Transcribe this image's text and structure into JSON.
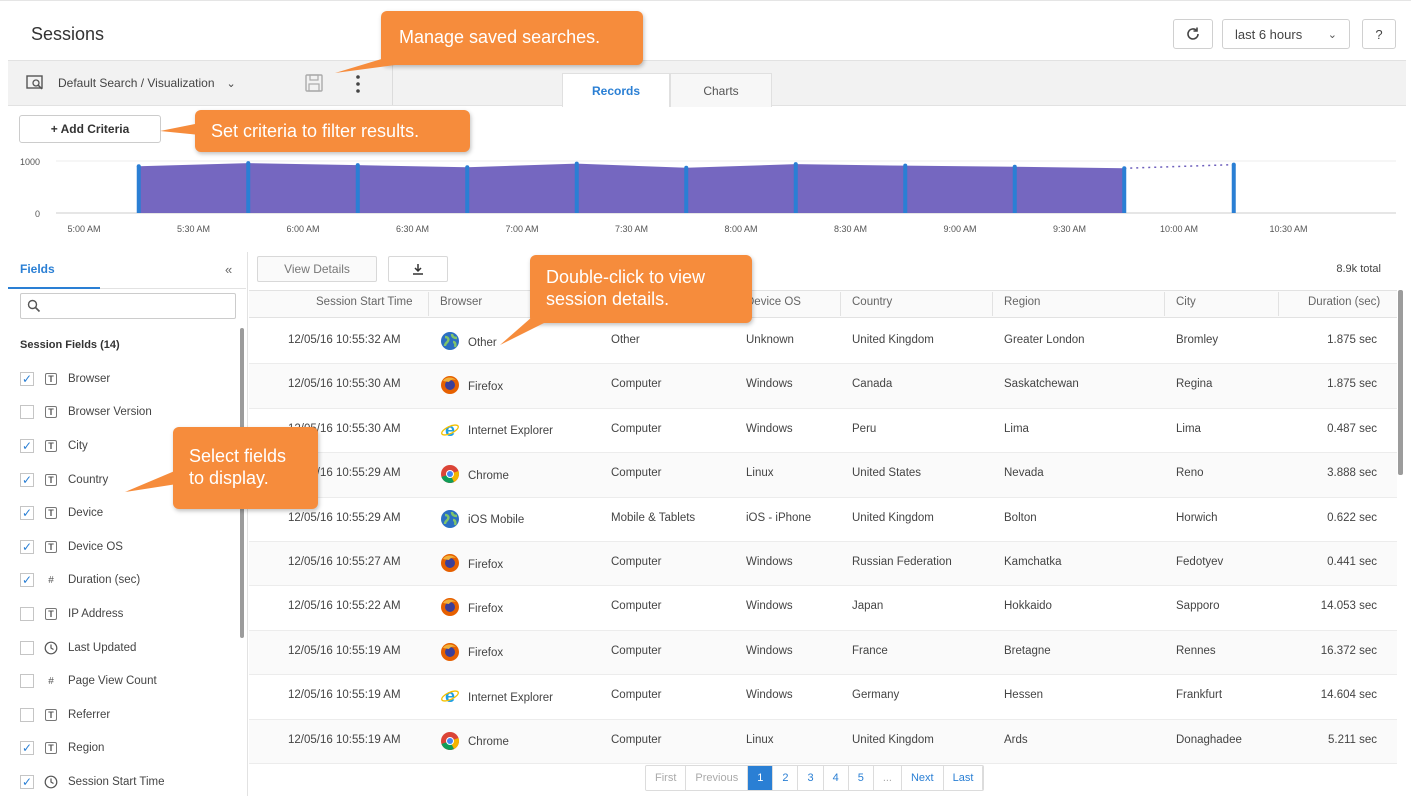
{
  "header": {
    "title": "Sessions",
    "time_range": "last 6 hours",
    "help": "?"
  },
  "toolbar": {
    "search_name": "Default Search / Visualization",
    "tabs": [
      "Records",
      "Charts"
    ],
    "add_criteria": "+ Add Criteria"
  },
  "callouts": {
    "saved": "Manage saved searches.",
    "criteria": "Set criteria to filter results.",
    "details": "Double-click to view session details.",
    "fields": "Select fields to display."
  },
  "chart_data": {
    "type": "area",
    "y_ticks": [
      "1000",
      "0"
    ],
    "x_ticks": [
      "5:00 AM",
      "5:30 AM",
      "6:00 AM",
      "6:30 AM",
      "7:00 AM",
      "7:30 AM",
      "8:00 AM",
      "8:30 AM",
      "9:00 AM",
      "9:30 AM",
      "10:00 AM",
      "10:30 AM"
    ],
    "ylim": [
      0,
      1000
    ],
    "x": [
      "5:15 AM",
      "5:45 AM",
      "6:15 AM",
      "6:45 AM",
      "7:15 AM",
      "7:45 AM",
      "8:15 AM",
      "8:45 AM",
      "9:15 AM",
      "9:45 AM",
      "10:15 AM"
    ],
    "values": [
      900,
      960,
      920,
      880,
      950,
      870,
      940,
      910,
      890,
      860,
      930
    ],
    "color": "#6e5fbd",
    "marker_color": "#2a7fd4"
  },
  "fields_panel": {
    "tab": "Fields",
    "collapse": "«",
    "section": "Session Fields (14)",
    "fields": [
      {
        "label": "Browser",
        "checked": true,
        "icon": "T"
      },
      {
        "label": "Browser Version",
        "checked": false,
        "icon": "T"
      },
      {
        "label": "City",
        "checked": true,
        "icon": "T"
      },
      {
        "label": "Country",
        "checked": true,
        "icon": "T"
      },
      {
        "label": "Device",
        "checked": true,
        "icon": "T"
      },
      {
        "label": "Device OS",
        "checked": true,
        "icon": "T"
      },
      {
        "label": "Duration (sec)",
        "checked": true,
        "icon": "#"
      },
      {
        "label": "IP Address",
        "checked": false,
        "icon": "T"
      },
      {
        "label": "Last Updated",
        "checked": false,
        "icon": "clock"
      },
      {
        "label": "Page View Count",
        "checked": false,
        "icon": "#"
      },
      {
        "label": "Referrer",
        "checked": false,
        "icon": "T"
      },
      {
        "label": "Region",
        "checked": true,
        "icon": "T"
      },
      {
        "label": "Session Start Time",
        "checked": true,
        "icon": "clock"
      }
    ]
  },
  "table": {
    "view_details": "View Details",
    "total": "8.9k total",
    "columns": [
      "Session Start Time",
      "Browser",
      "Device",
      "Device OS",
      "Country",
      "Region",
      "City",
      "Duration (sec)"
    ],
    "rows": [
      [
        "12/05/16 10:55:32 AM",
        "Other",
        "Other",
        "Unknown",
        "United Kingdom",
        "Greater London",
        "Bromley",
        "1.875 sec"
      ],
      [
        "12/05/16 10:55:30 AM",
        "Firefox",
        "Computer",
        "Windows",
        "Canada",
        "Saskatchewan",
        "Regina",
        "1.875 sec"
      ],
      [
        "12/05/16 10:55:30 AM",
        "Internet Explorer",
        "Computer",
        "Windows",
        "Peru",
        "Lima",
        "Lima",
        "0.487 sec"
      ],
      [
        "12/05/16 10:55:29 AM",
        "Chrome",
        "Computer",
        "Linux",
        "United States",
        "Nevada",
        "Reno",
        "3.888 sec"
      ],
      [
        "12/05/16 10:55:29 AM",
        "iOS Mobile",
        "Mobile & Tablets",
        "iOS - iPhone",
        "United Kingdom",
        "Bolton",
        "Horwich",
        "0.622 sec"
      ],
      [
        "12/05/16 10:55:27 AM",
        "Firefox",
        "Computer",
        "Windows",
        "Russian Federation",
        "Kamchatka",
        "Fedotyev",
        "0.441 sec"
      ],
      [
        "12/05/16 10:55:22 AM",
        "Firefox",
        "Computer",
        "Windows",
        "Japan",
        "Hokkaido",
        "Sapporo",
        "14.053 sec"
      ],
      [
        "12/05/16 10:55:19 AM",
        "Firefox",
        "Computer",
        "Windows",
        "France",
        "Bretagne",
        "Rennes",
        "16.372 sec"
      ],
      [
        "12/05/16 10:55:19 AM",
        "Internet Explorer",
        "Computer",
        "Windows",
        "Germany",
        "Hessen",
        "Frankfurt",
        "14.604 sec"
      ],
      [
        "12/05/16 10:55:19 AM",
        "Chrome",
        "Computer",
        "Linux",
        "United Kingdom",
        "Ards",
        "Donaghadee",
        "5.211 sec"
      ]
    ]
  },
  "pager": {
    "items": [
      "First",
      "Previous",
      "1",
      "2",
      "3",
      "4",
      "5",
      "...",
      "Next",
      "Last"
    ],
    "active": "1"
  }
}
